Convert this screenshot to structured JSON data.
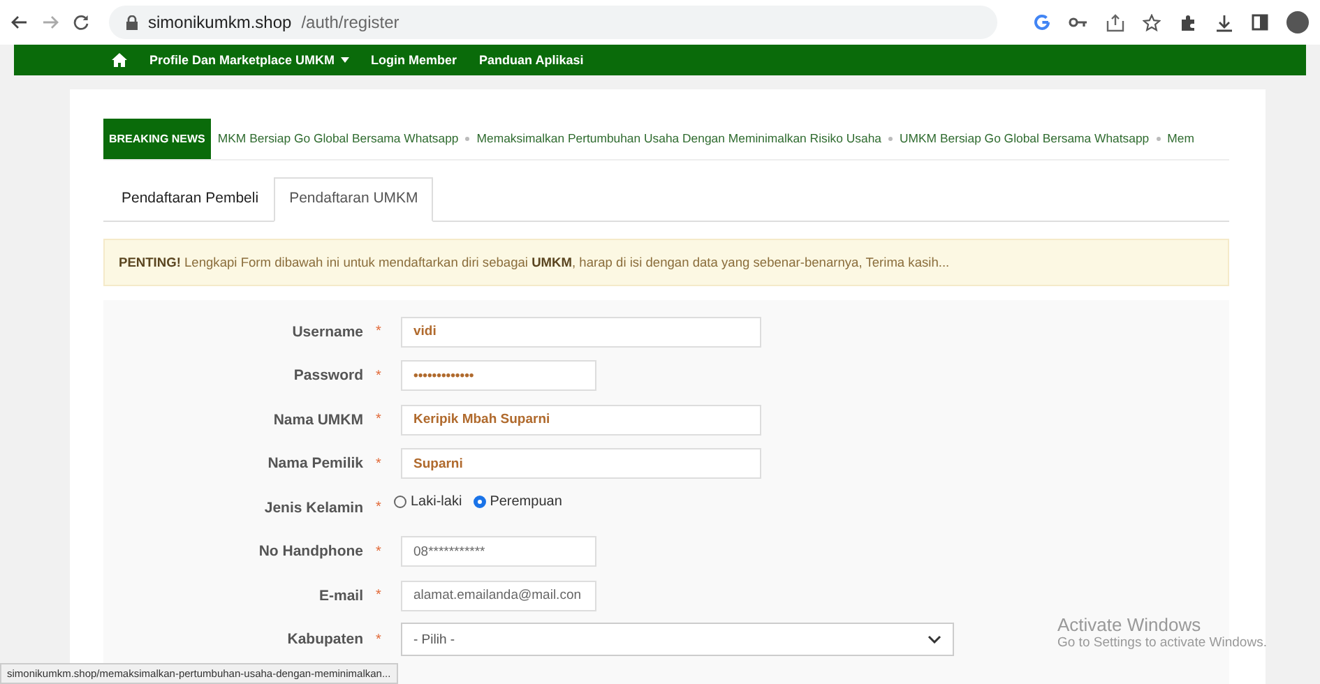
{
  "browser": {
    "url_host": "simonikumkm.shop",
    "url_path": "/auth/register"
  },
  "navbar": {
    "items": [
      {
        "label": "Profile Dan Marketplace UMKM",
        "dropdown": true
      },
      {
        "label": "Login Member",
        "dropdown": false
      },
      {
        "label": "Panduan Aplikasi",
        "dropdown": false
      }
    ]
  },
  "breaking_news": {
    "label": "BREAKING NEWS",
    "items": [
      "MKM Bersiap Go Global Bersama Whatsapp",
      "Memaksimalkan Pertumbuhan Usaha Dengan Meminimalkan Risiko Usaha",
      "UMKM Bersiap Go Global Bersama Whatsapp",
      "Mem"
    ]
  },
  "tabs": [
    {
      "label": "Pendaftaran Pembeli",
      "selected": false
    },
    {
      "label": "Pendaftaran UMKM",
      "selected": true
    }
  ],
  "alert": "**PENTING!** Lengkapi Form dibawah ini untuk mendaftarkan diri sebagai **UMKM**, harap di isi dengan data yang sebenar-benarnya, Terima kasih...",
  "form": [
    {
      "kind": "wide",
      "label": "Username",
      "value": "vidi",
      "bold": true
    },
    {
      "kind": "narrow",
      "label": "Password",
      "value": "•••••••••••••",
      "bold": true
    },
    {
      "kind": "wide",
      "label": "Nama UMKM",
      "value": "Keripik Mbah Suparni",
      "bold": true
    },
    {
      "kind": "wide",
      "label": "Nama Pemilik",
      "value": "Suparni",
      "bold": true
    },
    {
      "kind": "radio",
      "label": "Jenis Kelamin",
      "options": [
        {
          "label": "Laki-laki",
          "selected": false
        },
        {
          "label": "Perempuan",
          "selected": true
        }
      ]
    },
    {
      "kind": "narrow",
      "label": "No Handphone",
      "value": "08***********",
      "bold": false
    },
    {
      "kind": "narrow",
      "label": "E-mail",
      "value": "alamat.emailanda@mail.con",
      "bold": false
    },
    {
      "kind": "select",
      "label": "Kabupaten",
      "value": "- Pilih -"
    }
  ],
  "required_mark": "*",
  "status_url": "simonikumkm.shop/memaksimalkan-pertumbuhan-usaha-dengan-meminimalkan...",
  "os_notice": {
    "title": "Activate Windows",
    "text": "Go to Settings to activate Windows."
  }
}
